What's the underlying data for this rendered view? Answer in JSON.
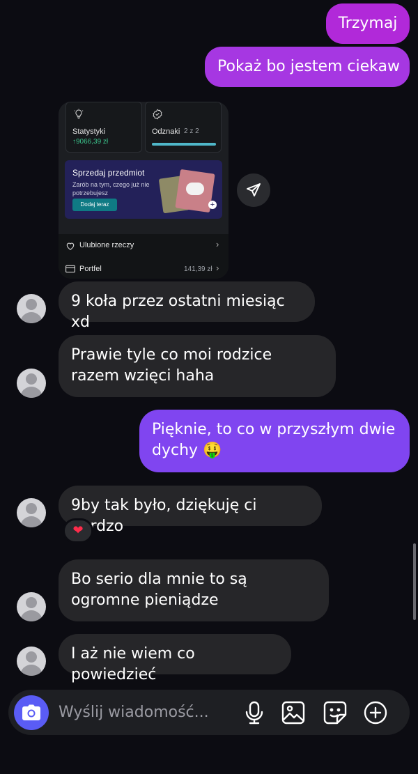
{
  "messages": {
    "m1": "Trzymaj",
    "m2": "Pokaż bo jestem ciekaw",
    "m3": "9 koła przez ostatni miesiąc xd",
    "m4": "Prawie tyle co moi rodzice razem wzięci haha",
    "m5": "Pięknie, to co w przyszłym dwie dychy 🤑",
    "m6": "9by tak było, dziękuję ci bardzo",
    "m7": "Bo serio dla mnie to są ogromne pieniądze",
    "m8": "I aż nie wiem co powiedzieć"
  },
  "reaction": {
    "emoji": "❤"
  },
  "shared_image": {
    "stats_title": "Statystyki",
    "stats_value": "↑9066,39 zł",
    "badges_title": "Odznaki",
    "badges_count": "2 z 2",
    "badges_progress": 1.0,
    "promo_title": "Sprzedaj przedmiot",
    "promo_desc": "Zarób na tym, czego już nie potrzebujesz",
    "promo_button": "Dodaj teraz",
    "favorites_label": "Ulubione rzeczy",
    "wallet_label": "Portfel",
    "wallet_value": "141,39 zł"
  },
  "composer": {
    "placeholder": "Wyślij wiadomość..."
  },
  "colors": {
    "outgoing_top": "#a72ee0",
    "outgoing_bottom": "#7f4cf4",
    "incoming": "#262629",
    "accent_green": "#3bc48c",
    "progress": "#4fb7c9"
  }
}
